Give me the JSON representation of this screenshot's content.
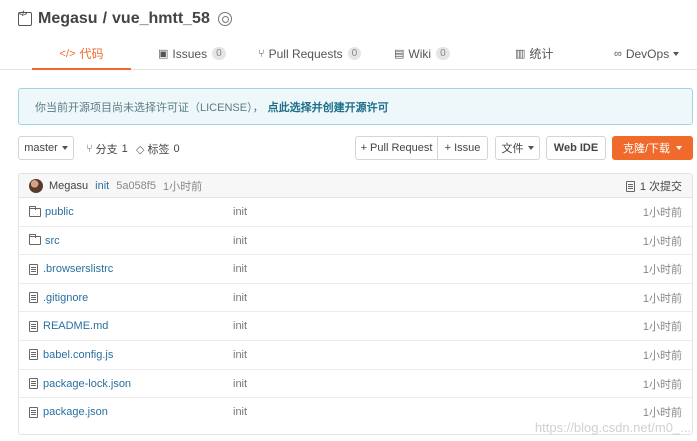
{
  "header": {
    "owner": "Megasu",
    "separator": "/",
    "repo": "vue_hmtt_58"
  },
  "tabs": [
    {
      "label": "代码",
      "icon": "code-icon",
      "active": true
    },
    {
      "label": "Issues",
      "icon": "issue-icon",
      "count": "0"
    },
    {
      "label": "Pull Requests",
      "icon": "pull-request-icon",
      "count": "0"
    },
    {
      "label": "Wiki",
      "icon": "wiki-icon",
      "count": "0"
    },
    {
      "label": "统计",
      "icon": "stats-icon"
    },
    {
      "label": "DevOps",
      "icon": "infinity-icon"
    }
  ],
  "notice": {
    "text": "你当前开源项目尚未选择许可证（LICENSE），",
    "link": "点此选择并创建开源许可"
  },
  "toolbar": {
    "branch": "master",
    "branches_label": "分支",
    "branches_count": "1",
    "tags_label": "标签",
    "tags_count": "0",
    "pull_request": "+ Pull Request",
    "issue": "+ Issue",
    "files": "文件",
    "web_ide": "Web IDE",
    "clone": "克隆/下载"
  },
  "commit": {
    "author": "Megasu",
    "message": "init",
    "sha": "5a058f5",
    "time": "1小时前",
    "count": "1 次提交"
  },
  "files": [
    {
      "name": "public",
      "type": "folder",
      "message": "init",
      "time": "1小时前"
    },
    {
      "name": "src",
      "type": "folder",
      "message": "init",
      "time": "1小时前"
    },
    {
      "name": ".browserslistrc",
      "type": "file",
      "message": "init",
      "time": "1小时前"
    },
    {
      "name": ".gitignore",
      "type": "file",
      "message": "init",
      "time": "1小时前"
    },
    {
      "name": "README.md",
      "type": "file",
      "message": "init",
      "time": "1小时前"
    },
    {
      "name": "babel.config.js",
      "type": "file",
      "message": "init",
      "time": "1小时前"
    },
    {
      "name": "package-lock.json",
      "type": "file",
      "message": "init",
      "time": "1小时前"
    },
    {
      "name": "package.json",
      "type": "file",
      "message": "init",
      "time": "1小时前"
    }
  ],
  "watermark": "https://blog.csdn.net/m0_..."
}
